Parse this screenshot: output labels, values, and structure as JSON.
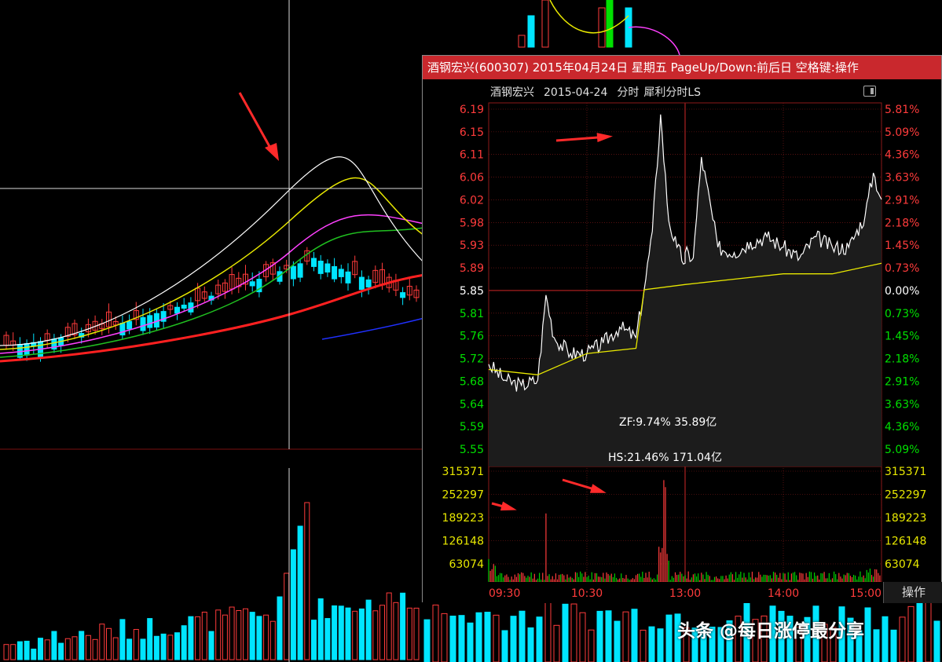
{
  "popup": {
    "title": "酒钢宏兴(600307) 2015年04月24日 星期五 PageUp/Down:前后日 空格键:操作",
    "header": {
      "stock_name": "酒钢宏兴",
      "date": "2015-04-24",
      "mode": "分时",
      "indicator": "犀利分时LS"
    },
    "annotation_zf": "ZF:9.74% 35.89亿",
    "annotation_hs": "HS:21.46% 171.04亿",
    "operate_tab": "操作"
  },
  "watermark": "头条 @每日涨停最分享",
  "colors": {
    "up": "#ff3b3b",
    "down": "#00e5ff",
    "price_line": "#ffffff",
    "avg_line": "#e8e800",
    "grid": "#8b1a1a",
    "title_bar": "#c9282d"
  },
  "chart_data": [
    {
      "type": "line",
      "panel": "intraday-price",
      "y_ticks": [
        "6.19",
        "6.15",
        "6.11",
        "6.06",
        "6.02",
        "5.98",
        "5.93",
        "5.89",
        "5.85",
        "5.81",
        "5.76",
        "5.72",
        "5.68",
        "5.64",
        "5.59",
        "5.55"
      ],
      "pct_ticks": [
        "5.81%",
        "5.09%",
        "4.36%",
        "3.63%",
        "2.91%",
        "2.18%",
        "1.45%",
        "0.73%",
        "0.00%",
        "0.73%",
        "1.45%",
        "2.18%",
        "2.91%",
        "3.63%",
        "4.36%",
        "5.09%"
      ],
      "x_ticks": [
        "09:30",
        "10:30",
        "13:00",
        "14:00",
        "15:00"
      ],
      "prev_close": 5.85,
      "ylim": [
        5.55,
        6.19
      ],
      "series": [
        {
          "values_time": [
            "09:30",
            "09:40",
            "09:50",
            "10:00",
            "10:05",
            "10:10",
            "10:20",
            "10:30",
            "10:40",
            "10:50",
            "11:00",
            "11:05",
            "11:10",
            "11:15",
            "11:20",
            "11:25",
            "11:30",
            "13:00",
            "13:05",
            "13:10",
            "13:20",
            "13:30",
            "13:40",
            "13:50",
            "14:00",
            "14:10",
            "14:20",
            "14:30",
            "14:40",
            "14:50",
            "14:55",
            "15:00"
          ],
          "values": [
            5.71,
            5.68,
            5.67,
            5.68,
            5.84,
            5.76,
            5.73,
            5.73,
            5.75,
            5.78,
            5.76,
            5.85,
            5.96,
            6.18,
            5.98,
            5.93,
            5.9,
            5.92,
            5.91,
            6.1,
            5.93,
            5.92,
            5.94,
            5.95,
            5.93,
            5.91,
            5.95,
            5.93,
            5.93,
            5.99,
            6.07,
            6.02
          ]
        },
        {
          "values_time": [
            "09:30",
            "10:00",
            "10:30",
            "11:00",
            "11:05",
            "11:30",
            "13:00",
            "13:30",
            "14:00",
            "14:30",
            "15:00"
          ],
          "values": [
            5.7,
            5.69,
            5.73,
            5.74,
            5.85,
            5.86,
            5.86,
            5.87,
            5.88,
            5.88,
            5.9
          ]
        }
      ]
    },
    {
      "type": "bar",
      "panel": "intraday-volume",
      "y_ticks": [
        "315371",
        "252297",
        "189223",
        "126148",
        "63074"
      ],
      "ylim": [
        0,
        315371
      ],
      "notable_bars": [
        {
          "time": "10:05",
          "value": 195000
        },
        {
          "time": "11:15",
          "value": 290000
        }
      ]
    }
  ]
}
